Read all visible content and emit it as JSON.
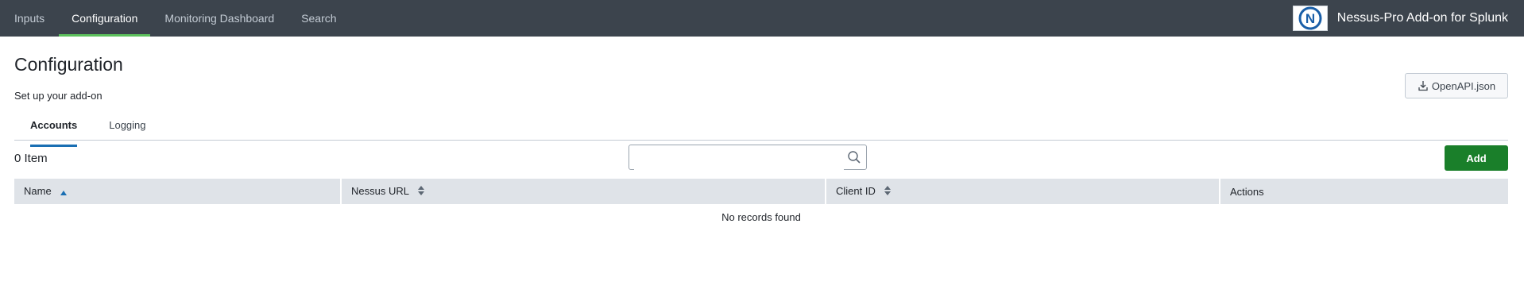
{
  "topbar": {
    "nav": [
      "Inputs",
      "Configuration",
      "Monitoring Dashboard",
      "Search"
    ],
    "active": "Configuration",
    "app_title": "Nessus-Pro Add-on for Splunk",
    "logo_letter": "N"
  },
  "page": {
    "title": "Configuration",
    "subtitle": "Set up your add-on",
    "openapi_label": "OpenAPI.json"
  },
  "tabs": [
    "Accounts",
    "Logging"
  ],
  "active_tab": "Accounts",
  "table": {
    "count_text": "0 Item",
    "search_value": "",
    "add_label": "Add",
    "columns": [
      "Name",
      "Nessus URL",
      "Client ID",
      "Actions"
    ],
    "sort_column": "Name",
    "empty_text": "No records found"
  },
  "colors": {
    "topbar": "#3c444d",
    "nav_active_underline": "#5cc05c",
    "tab_active_underline": "#1a6fb3",
    "add_button": "#1a7f2a",
    "table_header": "#dfe3e8"
  }
}
